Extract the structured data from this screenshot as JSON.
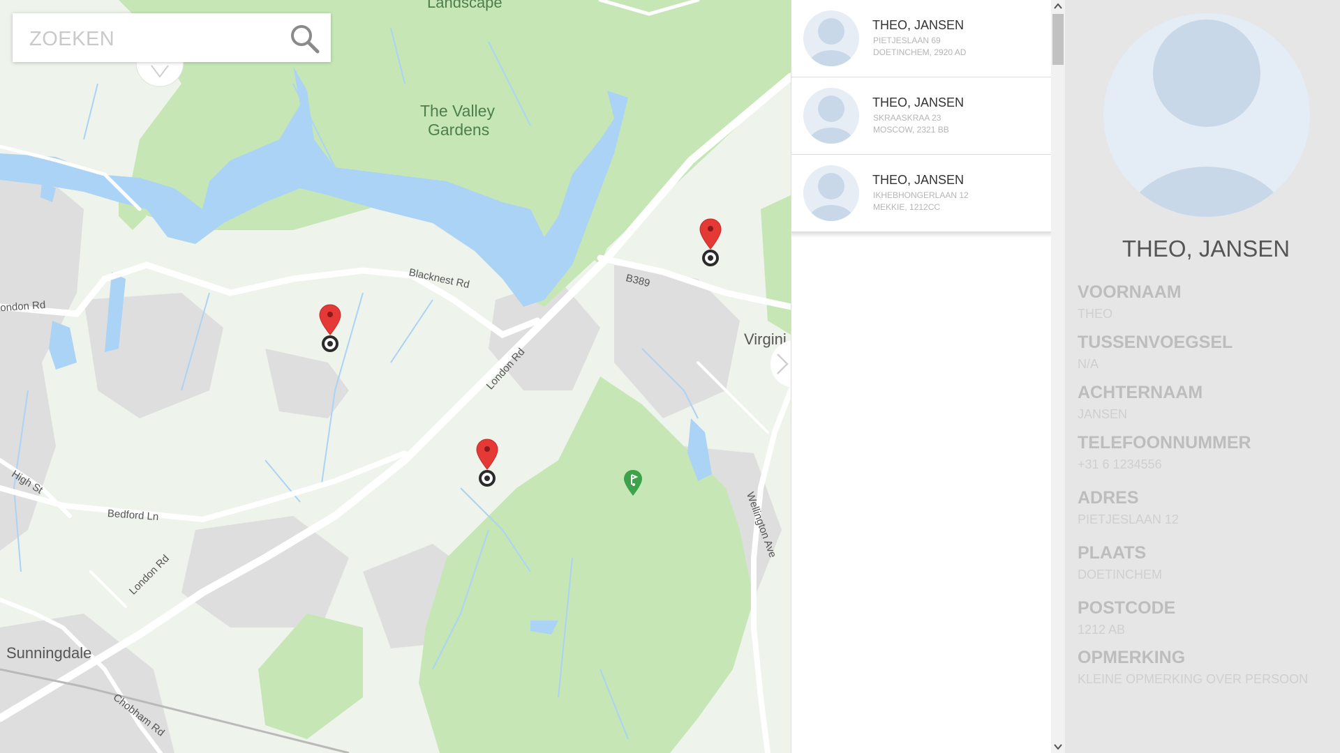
{
  "search": {
    "placeholder": "ZOEKEN"
  },
  "map": {
    "labels": {
      "landscape": "Landscape",
      "valley_line1": "The Valley",
      "valley_line2": "Gardens",
      "virginia": "Virgini",
      "sunningdale": "Sunningdale"
    },
    "roads": {
      "blacknest": "Blacknest Rd",
      "b389": "B389",
      "london_rd_top": "London Rd",
      "london_rd_mid": "London Rd",
      "london_rd_low": "London Rd",
      "high_st": "High St",
      "bedford": "Bedford Ln",
      "wellington": "Wellington Ave",
      "chobham": "Chobham Rd"
    },
    "colors": {
      "park": "#c8e8b8",
      "water": "#aad3f5",
      "urban": "#dcdcdc",
      "pin": "#e53935",
      "golf": "#3ca34a"
    }
  },
  "contacts": [
    {
      "name": "THEO, JANSEN",
      "address": "PIETJESLAAN 69",
      "city": "DOETINCHEM, 2920 AD"
    },
    {
      "name": "THEO, JANSEN",
      "address": "SKRAASKRAA 23",
      "city": "MOSCOW, 2321 BB"
    },
    {
      "name": "THEO, JANSEN",
      "address": "IKHEBHONGERLAAN 12",
      "city": "MEKKIE, 1212CC"
    }
  ],
  "detail": {
    "name": "THEO, JANSEN",
    "fields": [
      {
        "label": "VOORNAAM",
        "value": "THEO"
      },
      {
        "label": "TUSSENVOEGSEL",
        "value": "N/A"
      },
      {
        "label": "ACHTERNAAM",
        "value": "JANSEN"
      },
      {
        "label": "TELEFOONNUMMER",
        "value": "+31 6 1234556"
      },
      {
        "label": "ADRES",
        "value": "PIETJESLAAN 12"
      },
      {
        "label": "PLAATS",
        "value": "DOETINCHEM"
      },
      {
        "label": "POSTCODE",
        "value": "1212 AB"
      },
      {
        "label": "OPMERKING",
        "value": "KLEINE OPMERKING OVER PERSOON"
      }
    ]
  }
}
